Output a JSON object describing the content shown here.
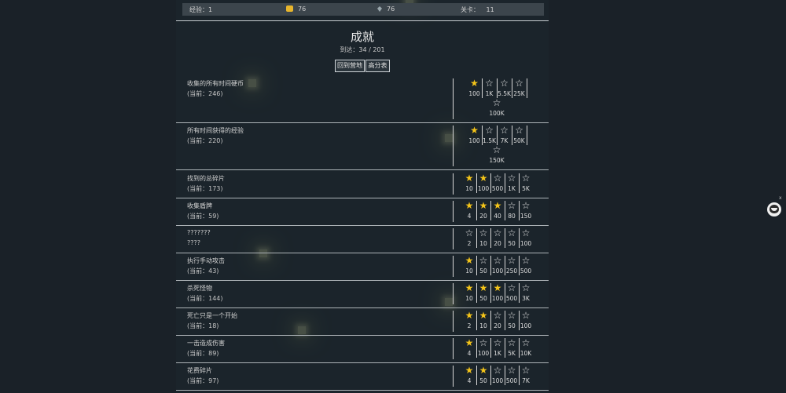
{
  "stats": {
    "exp_label": "经验：1",
    "coins": "76",
    "gems": "76",
    "level_label": "关卡：",
    "level_value": "11"
  },
  "title": "成就",
  "reached": "到达：34 / 201",
  "buttons": {
    "back": "回到营地",
    "highscores": "高分表"
  },
  "achievements": [
    {
      "name": "收集的所有时间硬币",
      "current": "(当前：246)",
      "tiers": [
        {
          "value": "100",
          "earned": true
        },
        {
          "value": "1K",
          "earned": false
        },
        {
          "value": "5.5K",
          "earned": false
        },
        {
          "value": "25K",
          "earned": false
        },
        {
          "value": "100K",
          "earned": false
        }
      ]
    },
    {
      "name": "所有时间获得的经验",
      "current": "(当前：220)",
      "tiers": [
        {
          "value": "100",
          "earned": true
        },
        {
          "value": "1.5K",
          "earned": false
        },
        {
          "value": "7K",
          "earned": false
        },
        {
          "value": "50K",
          "earned": false
        },
        {
          "value": "150K",
          "earned": false
        }
      ]
    },
    {
      "name": "找到的总碎片",
      "current": "(当前：173)",
      "tiers": [
        {
          "value": "10",
          "earned": true
        },
        {
          "value": "100",
          "earned": true
        },
        {
          "value": "500",
          "earned": false
        },
        {
          "value": "1K",
          "earned": false
        },
        {
          "value": "5K",
          "earned": false
        }
      ]
    },
    {
      "name": "收集盾牌",
      "current": "(当前：59)",
      "tiers": [
        {
          "value": "4",
          "earned": true
        },
        {
          "value": "20",
          "earned": true
        },
        {
          "value": "40",
          "earned": true
        },
        {
          "value": "80",
          "earned": false
        },
        {
          "value": "150",
          "earned": false
        }
      ]
    },
    {
      "name": "???????",
      "current": "????",
      "tiers": [
        {
          "value": "2",
          "earned": false
        },
        {
          "value": "10",
          "earned": false
        },
        {
          "value": "20",
          "earned": false
        },
        {
          "value": "50",
          "earned": false
        },
        {
          "value": "100",
          "earned": false
        }
      ]
    },
    {
      "name": "执行手动攻击",
      "current": "(当前：43)",
      "tiers": [
        {
          "value": "10",
          "earned": true
        },
        {
          "value": "50",
          "earned": false
        },
        {
          "value": "100",
          "earned": false
        },
        {
          "value": "250",
          "earned": false
        },
        {
          "value": "500",
          "earned": false
        }
      ]
    },
    {
      "name": "杀死怪物",
      "current": "(当前：144)",
      "tiers": [
        {
          "value": "10",
          "earned": true
        },
        {
          "value": "50",
          "earned": true
        },
        {
          "value": "100",
          "earned": true
        },
        {
          "value": "500",
          "earned": false
        },
        {
          "value": "3K",
          "earned": false
        }
      ]
    },
    {
      "name": "死亡只是一个开始",
      "current": "(当前：18)",
      "tiers": [
        {
          "value": "2",
          "earned": true
        },
        {
          "value": "10",
          "earned": true
        },
        {
          "value": "20",
          "earned": false
        },
        {
          "value": "50",
          "earned": false
        },
        {
          "value": "100",
          "earned": false
        }
      ]
    },
    {
      "name": "一击造成伤害",
      "current": "(当前：89)",
      "tiers": [
        {
          "value": "4",
          "earned": true
        },
        {
          "value": "100",
          "earned": false
        },
        {
          "value": "1K",
          "earned": false
        },
        {
          "value": "5K",
          "earned": false
        },
        {
          "value": "10K",
          "earned": false
        }
      ]
    },
    {
      "name": "花费碎片",
      "current": "(当前：97)",
      "tiers": [
        {
          "value": "4",
          "earned": true
        },
        {
          "value": "50",
          "earned": true
        },
        {
          "value": "100",
          "earned": false
        },
        {
          "value": "500",
          "earned": false
        },
        {
          "value": "7K",
          "earned": false
        }
      ]
    }
  ],
  "side": {
    "close": "x",
    "mascot_icon": "cat-face-icon"
  },
  "colors": {
    "star_earned": "#f4c419",
    "star_empty": "#e8e8e8",
    "background": "#1a2128"
  }
}
